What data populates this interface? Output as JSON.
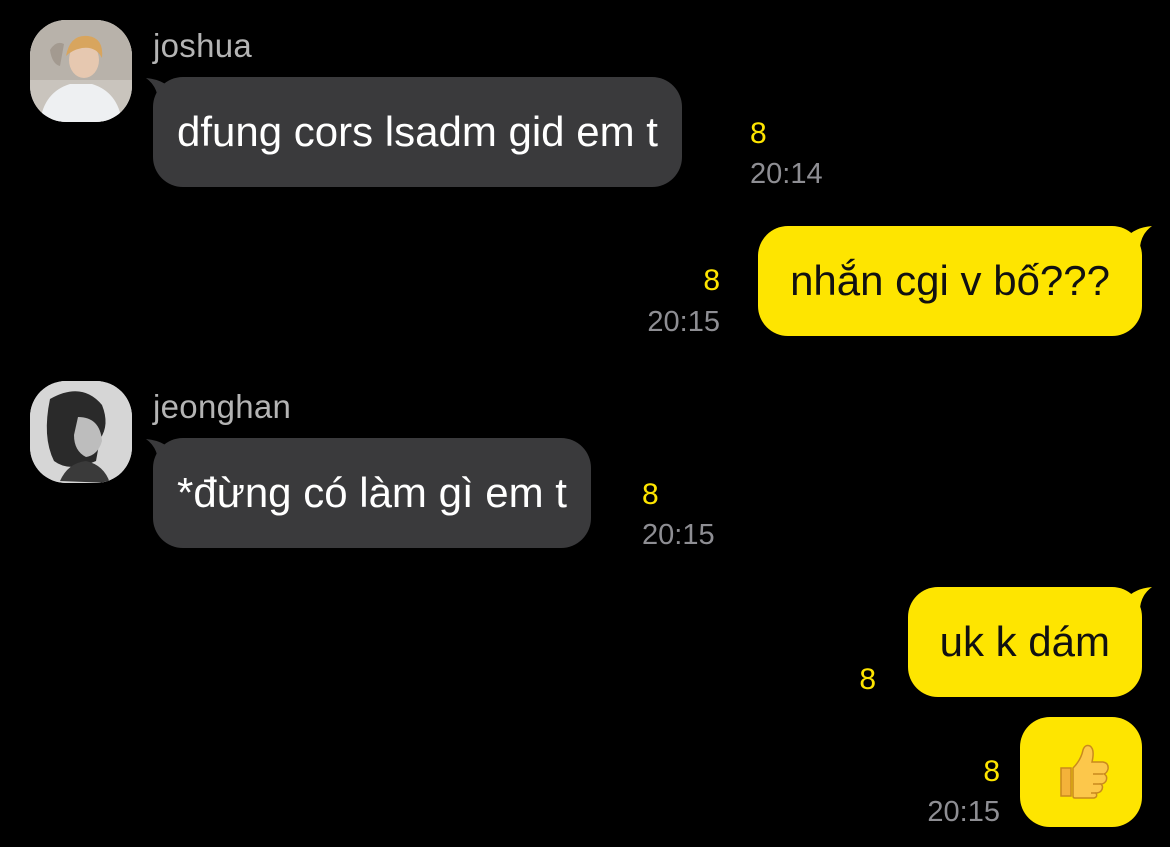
{
  "messages": [
    {
      "sender": "joshua",
      "text": "dfung cors lsadm gid em t",
      "unread": "8",
      "time": "20:14"
    },
    {
      "sender": "me",
      "text": "nhắn cgi v bố???",
      "unread": "8",
      "time": "20:15"
    },
    {
      "sender": "jeonghan",
      "text": "*đừng có làm gì em t",
      "unread": "8",
      "time": "20:15"
    },
    {
      "sender": "me",
      "text": "uk k dám",
      "unread": "8"
    },
    {
      "sender": "me",
      "emoji": "thumbs-up-emoji",
      "unread": "8",
      "time": "20:15"
    }
  ],
  "colors": {
    "background": "#000000",
    "incoming_bubble": "#3a3a3c",
    "outgoing_bubble": "#fee500",
    "unread_count": "#fee500",
    "timestamp": "#8e8e93"
  }
}
